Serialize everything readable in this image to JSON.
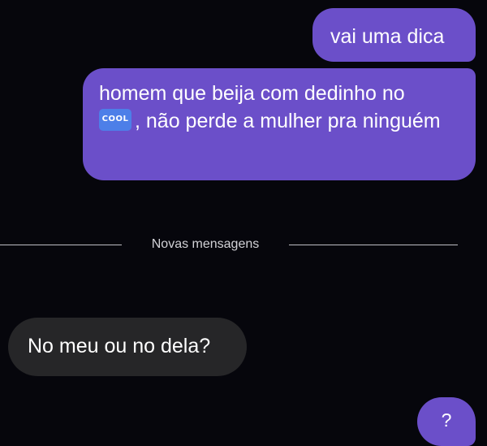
{
  "messages": [
    {
      "direction": "sent",
      "text": "vai uma dica"
    },
    {
      "direction": "sent",
      "text_before": "homem que beija com dedinho no",
      "emoji_label": "COOL",
      "text_after": ", não perde a mulher pra ninguém"
    },
    {
      "direction": "received",
      "text": "No meu ou no dela?"
    },
    {
      "direction": "sent",
      "text": "?"
    }
  ],
  "divider": {
    "label": "Novas mensagens"
  },
  "colors": {
    "background": "#06060c",
    "sent_bubble": "#6b4fc9",
    "received_bubble": "#262628",
    "cool_emoji": "#4d7fe8"
  },
  "icons": {
    "emoji": "cool-button-emoji"
  }
}
